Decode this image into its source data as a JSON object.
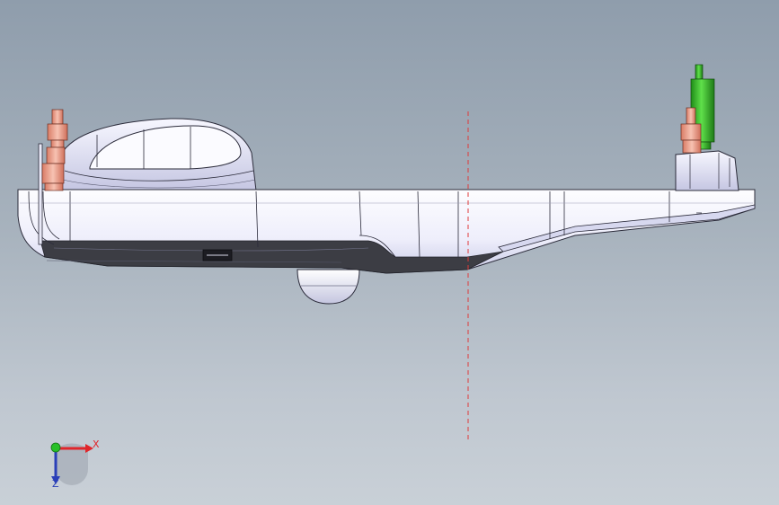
{
  "viewport": {
    "background_top": "#8f9dac",
    "background_bottom": "#c9d0d7"
  },
  "model": {
    "body_color": "#f4f4fd",
    "body_shade": "#b7b8d6",
    "edge_color": "#2b2b3a",
    "bottom_band_color": "#3c3d44",
    "left_standoff_color": "#f2a48f",
    "right_standoff_color": "#f2a48f",
    "pin_color": "#3cbf2a",
    "section_line_color": "#e03a3a"
  },
  "triad": {
    "x_axis": {
      "label": "X",
      "color": "#e0262b",
      "icon": "x-arrow-icon"
    },
    "z_axis": {
      "label": "Z",
      "color": "#2a3fb8",
      "icon": "z-arrow-icon"
    },
    "origin_color": "#28c028"
  }
}
